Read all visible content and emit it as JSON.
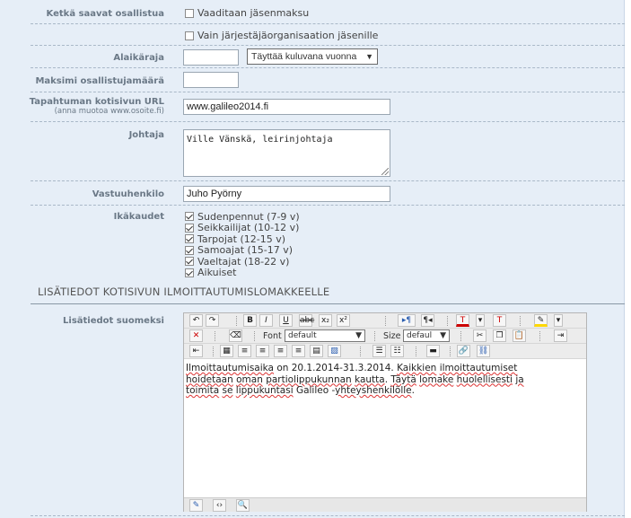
{
  "rows": {
    "participants_label": "Ketkä saavat osallistua",
    "require_fee": "Vaaditaan jäsenmaksu",
    "org_members_only": "Vain järjestäjäorganisaation jäsenille",
    "min_age_label": "Alaikäraja",
    "min_age_value": "",
    "age_mode": "Täyttää kuluvana vuonna",
    "max_participants_label": "Maksimi osallistujamäärä",
    "max_participants_value": "",
    "url_label": "Tapahtuman kotisivun URL",
    "url_hint": "(anna muotoa www.osoite.fi)",
    "url_value": "www.galileo2014.fi",
    "leader_label": "Johtaja",
    "leader_value": "Ville Vänskä, leirinjohtaja",
    "contact_label": "Vastuuhenkilo",
    "contact_value": "Juho Pyörny",
    "age_groups_label": "Ikäkaudet",
    "age_groups": [
      "Sudenpennut (7-9 v)",
      "Seikkailijat (10-12 v)",
      "Tarpojat (12-15 v)",
      "Samoajat (15-17 v)",
      "Vaeltajat (18-22 v)",
      "Aikuiset"
    ]
  },
  "section": {
    "title": "LISÄTIEDOT KOTISIVUN ILMOITTAUTUMISLOMAKKEELLE",
    "info_label": "Lisätiedot suomeksi"
  },
  "editor": {
    "font_label": "Font",
    "font_value": "default",
    "size_label": "Size",
    "size_value": "defaul",
    "content": {
      "w1": "Ilmoittautumisaika",
      "t1": " on 20.1.2014-31.3.2014. ",
      "w2": "Kaikkien",
      "t2": " ",
      "w3": "ilmoittautumiset",
      "w4": "hoidetaan",
      "t3": " ",
      "w5": "oman",
      "t4": " ",
      "w6": "partiolippukunnan",
      "t5": " ",
      "w7": "kautta",
      "t6": ". ",
      "w8": "Täytä",
      "t7": " ",
      "w9": "lomake",
      "t8": " ",
      "w10": "huolellisesti",
      "t9": " ",
      "w11": "ja",
      "w12": "toimita",
      "t10": " ",
      "w13": "se",
      "t11": " ",
      "w14": "lippukuntasi",
      "t12": " Galileo -",
      "w15": "yhteyshenkilölle",
      "t13": "."
    }
  }
}
